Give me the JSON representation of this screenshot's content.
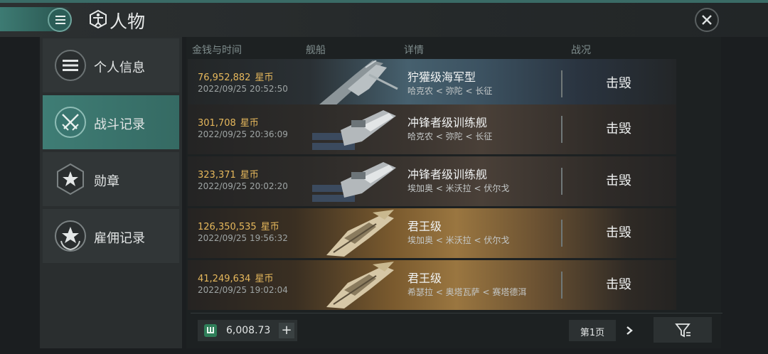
{
  "header": {
    "title": "人物",
    "menu_icon": "hamburger-menu-icon",
    "title_icon": "vitruvian-body-icon",
    "close_icon": "close-x-icon"
  },
  "sidebar": {
    "items": [
      {
        "label": "个人信息",
        "icon": "list-lines-icon",
        "active": false
      },
      {
        "label": "战斗记录",
        "icon": "crossed-swords-icon",
        "active": true
      },
      {
        "label": "勋章",
        "icon": "star-hexagon-icon",
        "active": false
      },
      {
        "label": "雇佣记录",
        "icon": "star-laurel-icon",
        "active": false
      }
    ]
  },
  "table": {
    "columns": [
      "金钱与时间",
      "舰船",
      "详情",
      "战况"
    ],
    "rows": [
      {
        "amount": "76,952,882",
        "unit": "星币",
        "time": "2022/09/25  20:52:50",
        "ship": "狞獾级海军型",
        "location": "哈克农 < 弥陀 < 长征",
        "status": "击毁"
      },
      {
        "amount": "301,708",
        "unit": "星币",
        "time": "2022/09/25  20:36:09",
        "ship": "冲锋者级训练舰",
        "location": "哈克农 < 弥陀 < 长征",
        "status": "击毁"
      },
      {
        "amount": "323,371",
        "unit": "星币",
        "time": "2022/09/25  20:02:20",
        "ship": "冲锋者级训练舰",
        "location": "埃加奥 < 米沃拉 < 伏尔戈",
        "status": "击毁"
      },
      {
        "amount": "126,350,535",
        "unit": "星币",
        "time": "2022/09/25  19:56:32",
        "ship": "君王级",
        "location": "埃加奥 < 米沃拉 < 伏尔戈",
        "status": "击毁"
      },
      {
        "amount": "41,249,634",
        "unit": "星币",
        "time": "2022/09/25  19:02:04",
        "ship": "君王级",
        "location": "希瑟拉 < 奥塔瓦萨 < 赛塔德洱",
        "status": "击毁"
      }
    ]
  },
  "footer": {
    "wallet_value": "6,008.73",
    "wallet_icon": "currency-icon",
    "add_label": "+",
    "page_label": "第1页",
    "next_icon": "chevron-right-icon",
    "filter_icon": "filter-icon"
  },
  "colors": {
    "accent": "#3f7d75",
    "money": "#e6b85c"
  }
}
